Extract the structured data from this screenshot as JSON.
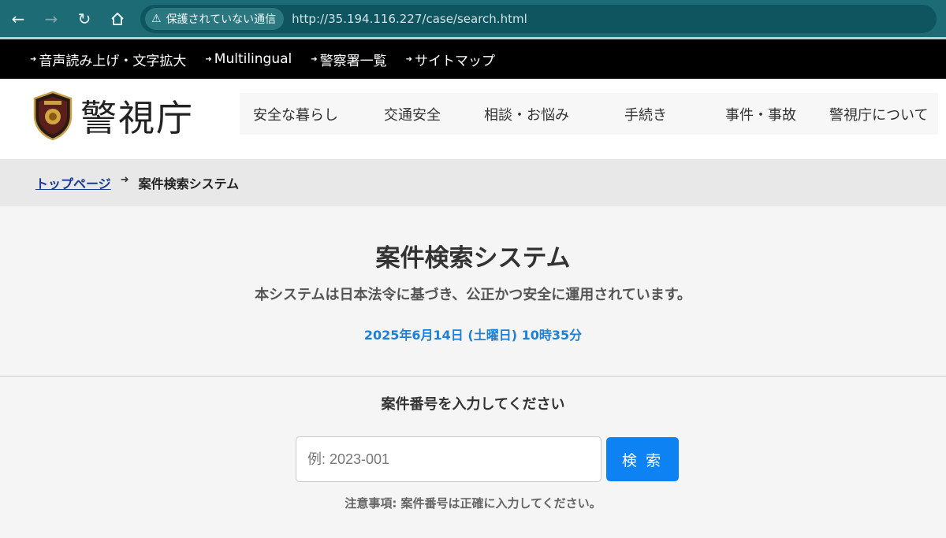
{
  "browser": {
    "security_label": "保護されていない通信",
    "url": "http://35.194.116.227/case/search.html",
    "icons": [
      "back-arrow-icon",
      "forward-arrow-icon",
      "reload-icon",
      "home-icon",
      "warning-triangle-icon"
    ]
  },
  "utility_links": [
    {
      "label": "音声読み上げ・文字拡大"
    },
    {
      "label": "Multilingual"
    },
    {
      "label": "警察署一覧"
    },
    {
      "label": "サイトマップ"
    }
  ],
  "logo": {
    "text": "警視庁"
  },
  "main_nav": [
    {
      "label": "安全な暮らし"
    },
    {
      "label": "交通安全"
    },
    {
      "label": "相談・お悩み"
    },
    {
      "label": "手続き"
    },
    {
      "label": "事件・事故"
    },
    {
      "label": "警視庁について"
    }
  ],
  "breadcrumb": {
    "home": "トップページ",
    "current": "案件検索システム"
  },
  "hero": {
    "title": "案件検索システム",
    "subtitle": "本システムは日本法令に基づき、公正かつ安全に運用されています。",
    "datetime": "2025年6月14日 (土曜日) 10時35分"
  },
  "search": {
    "heading": "案件番号を入力してください",
    "placeholder": "例: 2023-001",
    "value": "",
    "button_label": "検 索",
    "notice": "注意事項: 案件番号は正確に入力してください。"
  },
  "colors": {
    "browser_bar": "#1d6b74",
    "utility_bar": "#000000",
    "accent_blue": "#0d82f2",
    "date_blue": "#1e7fd6"
  }
}
